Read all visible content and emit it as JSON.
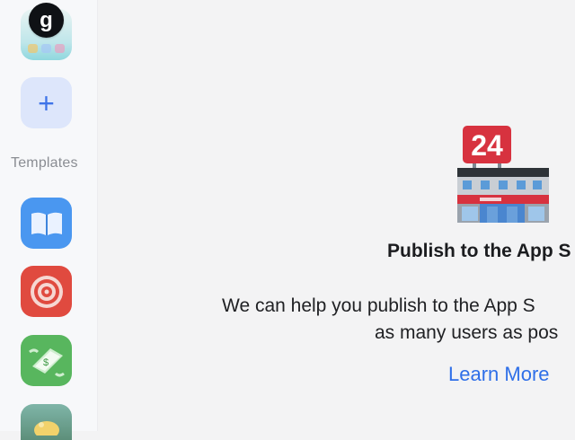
{
  "sidebar": {
    "current_app_badge": "g",
    "add_button_symbol": "+",
    "templates_label": "Templates",
    "templates": [
      {
        "icon": "book-icon"
      },
      {
        "icon": "target-icon"
      },
      {
        "icon": "money-icon"
      },
      {
        "icon": "piggy-bank-icon"
      }
    ]
  },
  "main": {
    "illustration_icon": "24-hour-store-icon",
    "store_sign_text": "24",
    "headline": "Publish to the App S",
    "body_line_1": "We can help you publish to the App S",
    "body_line_2": "as many users as pos",
    "learn_more_label": "Learn More"
  },
  "colors": {
    "accent": "#2f6fe8",
    "store_red": "#d7323f",
    "store_gray": "#9aa3ad"
  }
}
